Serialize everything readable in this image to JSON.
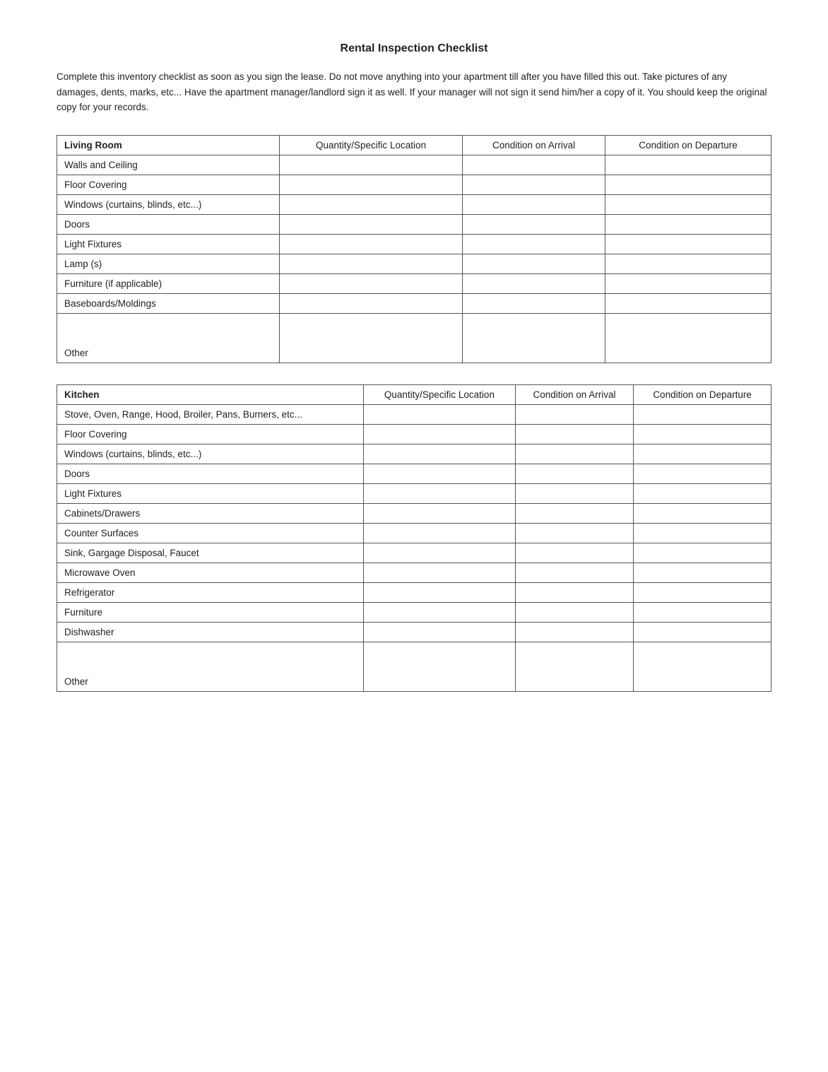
{
  "page": {
    "title": "Rental Inspection Checklist",
    "intro": "Complete this inventory checklist as soon as you sign the lease.  Do not move anything into your apartment till after you have filled this out.  Take pictures of any damages, dents, marks, etc... Have the apartment manager/landlord sign it as well.  If your manager will not sign it send him/her a copy of it.  You should keep the original copy for your records."
  },
  "living_room": {
    "section_label": "Living Room",
    "col2": "Quantity/Specific Location",
    "col3": "Condition on Arrival",
    "col4": "Condition on Departure",
    "rows": [
      {
        "item": "Walls and Ceiling"
      },
      {
        "item": "Floor Covering"
      },
      {
        "item": "Windows (curtains, blinds, etc...)"
      },
      {
        "item": "Doors"
      },
      {
        "item": "Light Fixtures"
      },
      {
        "item": "Lamp (s)"
      },
      {
        "item": "Furniture (if applicable)"
      },
      {
        "item": "Baseboards/Moldings"
      },
      {
        "item": "Other",
        "tall": true
      }
    ]
  },
  "kitchen": {
    "section_label": "Kitchen",
    "col2": "Quantity/Specific Location",
    "col3": "Condition on Arrival",
    "col4": "Condition on Departure",
    "rows": [
      {
        "item": "Stove, Oven, Range, Hood, Broiler, Pans, Burners, etc..."
      },
      {
        "item": "Floor Covering"
      },
      {
        "item": "Windows (curtains, blinds, etc...)"
      },
      {
        "item": "Doors"
      },
      {
        "item": "Light Fixtures"
      },
      {
        "item": "Cabinets/Drawers"
      },
      {
        "item": "Counter Surfaces"
      },
      {
        "item": "Sink, Gargage Disposal, Faucet"
      },
      {
        "item": "Microwave Oven"
      },
      {
        "item": "Refrigerator"
      },
      {
        "item": "Furniture"
      },
      {
        "item": "Dishwasher"
      },
      {
        "item": "Other",
        "tall": true
      }
    ]
  }
}
